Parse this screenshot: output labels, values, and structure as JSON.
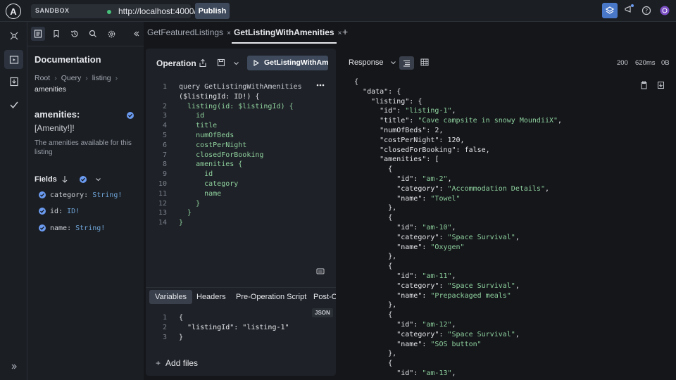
{
  "topbar": {
    "env_tag": "SANDBOX",
    "url": "http://localhost:4000/",
    "publish_label": "Publish"
  },
  "tabs": [
    {
      "label": "GetFeaturedListings",
      "close": "×"
    },
    {
      "label": "GetListingWithAmenities",
      "close": "×"
    }
  ],
  "add_tab": "+",
  "documentation": {
    "title": "Documentation",
    "breadcrumb": [
      "Root",
      "Query",
      "listing"
    ],
    "current": "amenities",
    "field_name": "amenities:",
    "field_type": "[Amenity!]!",
    "field_description": "The amenities available for this listing",
    "fields_label": "Fields",
    "fields": [
      {
        "name": "category:",
        "type": "String!"
      },
      {
        "name": "id:",
        "type": "ID!"
      },
      {
        "name": "name:",
        "type": "String!"
      }
    ]
  },
  "operation": {
    "title": "Operation",
    "run_label": "GetListingWithAmenities",
    "code": [
      {
        "n": "1",
        "t": "query GetListingWithAmenities"
      },
      {
        "n": "",
        "t": "($listingId: ID!) {"
      },
      {
        "n": "2",
        "t": "  listing(id: $listingId) {"
      },
      {
        "n": "3",
        "t": "    id"
      },
      {
        "n": "4",
        "t": "    title"
      },
      {
        "n": "5",
        "t": "    numOfBeds"
      },
      {
        "n": "6",
        "t": "    costPerNight"
      },
      {
        "n": "7",
        "t": "    closedForBooking"
      },
      {
        "n": "8",
        "t": "    amenities {"
      },
      {
        "n": "9",
        "t": "      id"
      },
      {
        "n": "10",
        "t": "      category"
      },
      {
        "n": "11",
        "t": "      name"
      },
      {
        "n": "12",
        "t": "    }"
      },
      {
        "n": "13",
        "t": "  }"
      },
      {
        "n": "14",
        "t": "}"
      }
    ],
    "var_tabs": [
      "Variables",
      "Headers",
      "Pre-Operation Script",
      "Post-O"
    ],
    "json_badge": "JSON",
    "variables": [
      {
        "n": "1",
        "t": "{"
      },
      {
        "n": "2",
        "t": "  \"listingId\": \"listing-1\""
      },
      {
        "n": "3",
        "t": "}"
      }
    ],
    "add_files": "Add files"
  },
  "response": {
    "label": "Response",
    "status": "200",
    "time": "620ms",
    "size": "0B",
    "lines": [
      "{",
      "  \"data\": {",
      "    \"listing\": {",
      "      \"id\": \"listing-1\",",
      "      \"title\": \"Cave campsite in snowy MoundiiX\",",
      "      \"numOfBeds\": 2,",
      "      \"costPerNight\": 120,",
      "      \"closedForBooking\": false,",
      "      \"amenities\": [",
      "        {",
      "          \"id\": \"am-2\",",
      "          \"category\": \"Accommodation Details\",",
      "          \"name\": \"Towel\"",
      "        },",
      "        {",
      "          \"id\": \"am-10\",",
      "          \"category\": \"Space Survival\",",
      "          \"name\": \"Oxygen\"",
      "        },",
      "        {",
      "          \"id\": \"am-11\",",
      "          \"category\": \"Space Survival\",",
      "          \"name\": \"Prepackaged meals\"",
      "        },",
      "        {",
      "          \"id\": \"am-12\",",
      "          \"category\": \"Space Survival\",",
      "          \"name\": \"SOS button\"",
      "        },",
      "        {",
      "          \"id\": \"am-13\","
    ]
  },
  "colors": {
    "background": "#14161a",
    "panel": "#1e2127",
    "accent": "#6b9bf0",
    "status_ok": "#47c07a"
  }
}
